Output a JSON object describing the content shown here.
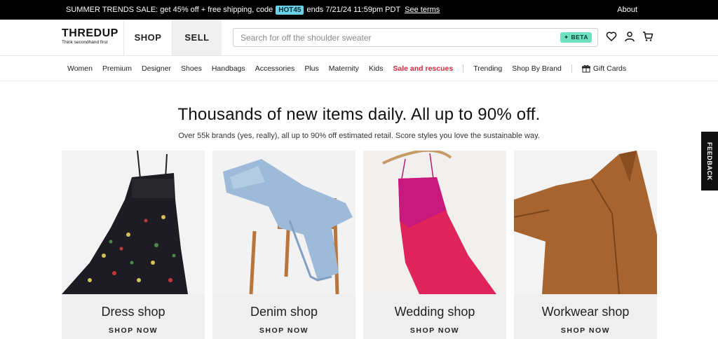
{
  "promo": {
    "text_before": "SUMMER TRENDS SALE: get 45% off + free shipping, code",
    "code": "HOT45",
    "text_after": "ends 7/21/24 11:59pm PDT",
    "terms": "See terms",
    "about": "About"
  },
  "header": {
    "logo": "THREDUP",
    "tagline": "Think secondhand first",
    "tabs": [
      "SHOP",
      "SELL"
    ],
    "search_placeholder": "Search for off the shoulder sweater",
    "beta": "✦ BETA"
  },
  "nav": {
    "items": [
      "Women",
      "Premium",
      "Designer",
      "Shoes",
      "Handbags",
      "Accessories",
      "Plus",
      "Maternity",
      "Kids",
      "Sale and rescues"
    ],
    "extra": [
      "Trending",
      "Shop By Brand"
    ],
    "gift": "Gift Cards"
  },
  "hero": {
    "headline": "Thousands of new items daily. All up to 90% off.",
    "subline": "Over 55k brands (yes, really), all up to 90% off estimated retail. Score styles you love the sustainable way."
  },
  "cards": [
    {
      "title": "Dress shop",
      "cta": "SHOP NOW"
    },
    {
      "title": "Denim shop",
      "cta": "SHOP NOW"
    },
    {
      "title": "Wedding shop",
      "cta": "SHOP NOW"
    },
    {
      "title": "Workwear shop",
      "cta": "SHOP NOW"
    }
  ],
  "feedback": "FEEDBACK",
  "colors": {
    "sale": "#d6263c",
    "beta": "#6fe0c2",
    "code": "#6ad2e8"
  }
}
